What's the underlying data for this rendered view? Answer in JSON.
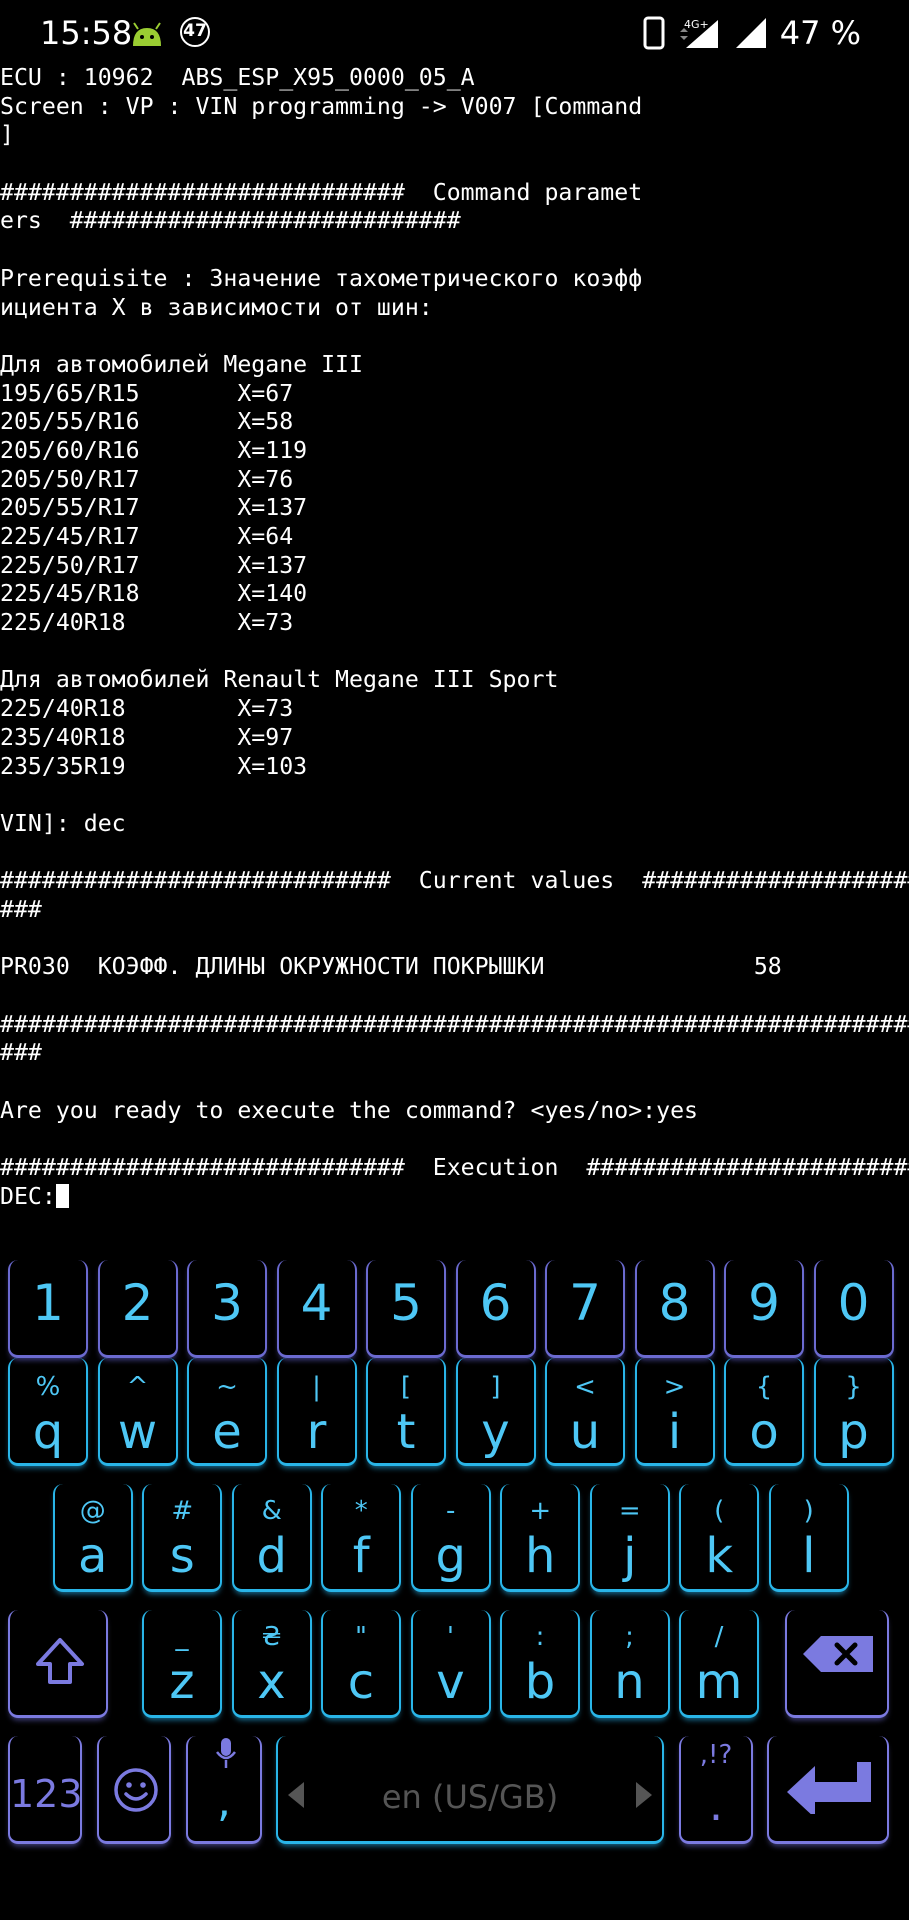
{
  "status_bar": {
    "time": "15:58",
    "notification_count": "47",
    "network": "4G+",
    "battery": "47 %"
  },
  "terminal": {
    "lines": [
      "ECU : 10962  ABS_ESP_X95_0000_05_A",
      "Screen : VP : VIN programming -> V007 [Command",
      "]",
      "",
      "#############################  Command paramet",
      "ers  ############################",
      "",
      "Prerequisite : Значение тахометрического коэфф",
      "ициента X в зависимости от шин:",
      "",
      "Для автомобилей Megane III",
      "195/65/R15       X=67",
      "205/55/R16       X=58",
      "205/60/R16       X=119",
      "205/50/R17       X=76",
      "205/55/R17       X=137",
      "225/45/R17       X=64",
      "225/50/R17       X=137",
      "225/45/R18       X=140",
      "225/40R18        X=73",
      "",
      "Для автомобилей Renault Megane III Sport",
      "225/40R18        X=73",
      "235/40R18        X=97",
      "235/35R19        X=103",
      "",
      "VIN]: dec",
      "",
      "############################  Current values  ######################",
      "###",
      "",
      "PR030  КОЭФФ. ДЛИНЫ ОКРУЖНОСТИ ПОКРЫШКИ               58",
      "",
      "###################################################################",
      "###",
      "",
      "Are you ready to execute the command? <yes/no>:yes",
      "",
      "#############################  Execution  ##########################",
      "DEC:"
    ]
  },
  "keyboard": {
    "number_row": [
      "1",
      "2",
      "3",
      "4",
      "5",
      "6",
      "7",
      "8",
      "9",
      "0"
    ],
    "row1": [
      {
        "main": "q",
        "sub": "%"
      },
      {
        "main": "w",
        "sub": "^"
      },
      {
        "main": "e",
        "sub": "~"
      },
      {
        "main": "r",
        "sub": "|"
      },
      {
        "main": "t",
        "sub": "["
      },
      {
        "main": "y",
        "sub": "]"
      },
      {
        "main": "u",
        "sub": "<"
      },
      {
        "main": "i",
        "sub": ">"
      },
      {
        "main": "o",
        "sub": "{"
      },
      {
        "main": "p",
        "sub": "}"
      }
    ],
    "row2": [
      {
        "main": "a",
        "sub": "@"
      },
      {
        "main": "s",
        "sub": "#"
      },
      {
        "main": "d",
        "sub": "&"
      },
      {
        "main": "f",
        "sub": "*"
      },
      {
        "main": "g",
        "sub": "-"
      },
      {
        "main": "h",
        "sub": "+"
      },
      {
        "main": "j",
        "sub": "="
      },
      {
        "main": "k",
        "sub": "("
      },
      {
        "main": "l",
        "sub": ")"
      }
    ],
    "row3": [
      {
        "main": "z",
        "sub": "_"
      },
      {
        "main": "x",
        "sub": "₴"
      },
      {
        "main": "c",
        "sub": "\""
      },
      {
        "main": "v",
        "sub": "'"
      },
      {
        "main": "b",
        "sub": ":"
      },
      {
        "main": "n",
        "sub": ";"
      },
      {
        "main": "m",
        "sub": "/"
      }
    ],
    "symbols_label": "123",
    "comma_label": ",",
    "space_label": "en (US/GB)",
    "period_label": ".",
    "period_sub": ",!?",
    "colors": {
      "letter": "#29b5e8",
      "function": "#7b7ae0",
      "text": "#4ec7f5"
    },
    "icons": {
      "shift": "shift-icon",
      "backspace": "backspace-icon",
      "emoji": "emoji-icon",
      "mic": "mic-icon",
      "enter": "enter-icon"
    }
  }
}
